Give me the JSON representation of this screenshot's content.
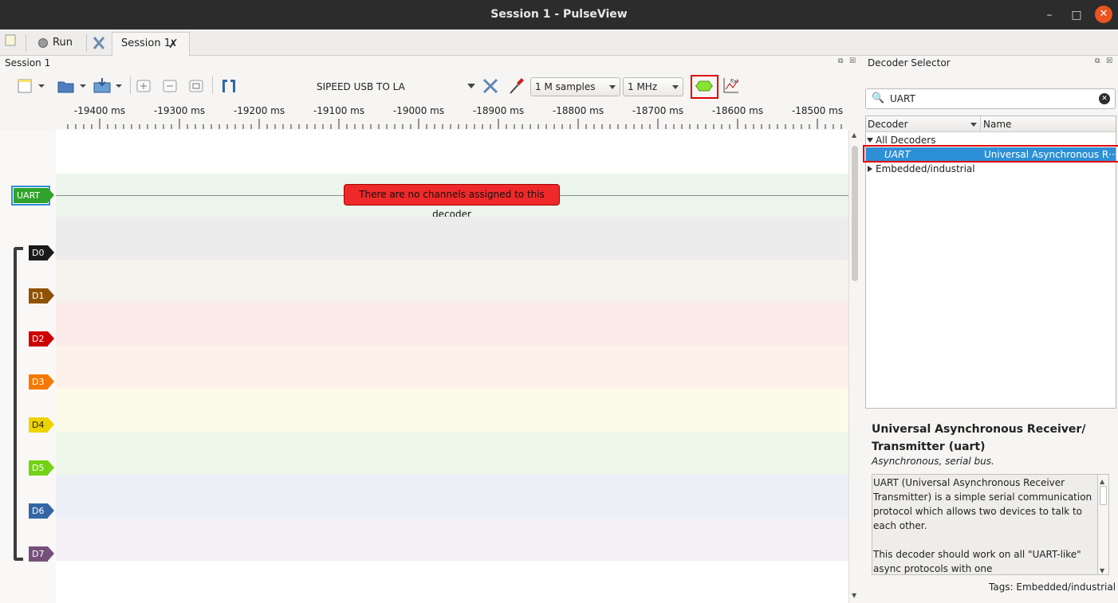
{
  "window": {
    "title": "Session 1 - PulseView",
    "minimize": "–",
    "maximize": "□",
    "close": "✕"
  },
  "tabs": {
    "run_label": "Run",
    "session_label": "Session 1",
    "session_close": "✗"
  },
  "session": {
    "panel_title": "Session 1",
    "device": "SIPEED USB TO LA",
    "samples": "1 M samples",
    "rate": "1 MHz"
  },
  "ruler": {
    "ticks": [
      "-19400 ms",
      "-19300 ms",
      "-19200 ms",
      "-19100 ms",
      "-19000 ms",
      "-18900 ms",
      "-18800 ms",
      "-18700 ms",
      "-18600 ms",
      "-18500 ms"
    ]
  },
  "traces": {
    "uart": {
      "label": "UART",
      "message": "There are no channels assigned to this decoder",
      "color": "#2fa32c"
    },
    "channels": [
      {
        "label": "D0",
        "color": "#1a1a1a",
        "band": "#ececec"
      },
      {
        "label": "D1",
        "color": "#8f5202",
        "band": "#f6f3ef"
      },
      {
        "label": "D2",
        "color": "#cc0000",
        "band": "#faeaea"
      },
      {
        "label": "D3",
        "color": "#f57900",
        "band": "#fdf1ea"
      },
      {
        "label": "D4",
        "color": "#edd400",
        "band": "#fcfbea"
      },
      {
        "label": "D5",
        "color": "#73d216",
        "band": "#eff6ea"
      },
      {
        "label": "D6",
        "color": "#3465a4",
        "band": "#ecf0f6"
      },
      {
        "label": "D7",
        "color": "#75507b",
        "band": "#f3f0f5"
      }
    ]
  },
  "decoder_selector": {
    "title": "Decoder Selector",
    "search_value": "UART",
    "columns": [
      "Decoder",
      "Name"
    ],
    "tree": {
      "group_all": "All Decoders",
      "uart_id": "UART",
      "uart_name": "Universal Asynchronous R···",
      "group_embedded": "Embedded/industrial"
    },
    "description": {
      "title": "Universal Asynchronous Receiver/ Transmitter (uart)",
      "subtitle": "Asynchronous, serial bus.",
      "text": "UART (Universal Asynchronous Receiver Transmitter) is a simple serial communication protocol which allows two devices to talk to each other.\n\nThis decoder should work on all \"UART-like\" async protocols with one",
      "tags": "Tags: Embedded/industrial"
    }
  }
}
